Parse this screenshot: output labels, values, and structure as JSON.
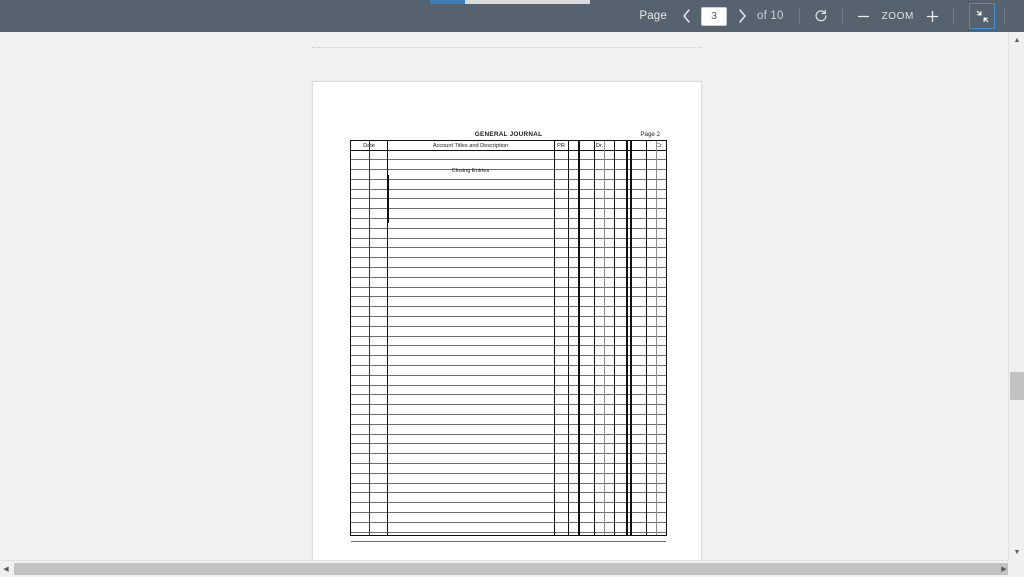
{
  "toolbar": {
    "page_label": "Page",
    "prev_icon": "chevron-left-icon",
    "page_value": "3",
    "next_icon": "chevron-right-icon",
    "total_label": "of 10",
    "rotate_icon": "rotate-icon",
    "zoom_out_label": "−",
    "zoom_label": "ZOOM",
    "zoom_in_label": "+",
    "fullscreen_icon": "exit-fullscreen-icon",
    "accent_color": "#3d8fd6",
    "bar_color": "#56636f"
  },
  "progress": {
    "fill_color": "#3d7eb5",
    "track_color": "#d8dadb",
    "percent": 22
  },
  "document": {
    "title": "GENERAL JOURNAL",
    "page_marker": "Page 2",
    "columns": [
      {
        "label": "Date",
        "key": "date"
      },
      {
        "label": "Account Titles and Description",
        "key": "account"
      },
      {
        "label": "PR",
        "key": "pr"
      },
      {
        "label": "Dr.",
        "key": "dr"
      },
      {
        "label": "Cr.",
        "key": "cr"
      }
    ],
    "body_text": "Closing Entries",
    "row_count": 40,
    "rows": []
  },
  "scrollbars": {
    "vertical_up_icon": "triangle-up-icon",
    "vertical_down_icon": "triangle-down-icon",
    "horizontal_left_icon": "triangle-left-icon",
    "horizontal_right_icon": "triangle-right-icon"
  }
}
